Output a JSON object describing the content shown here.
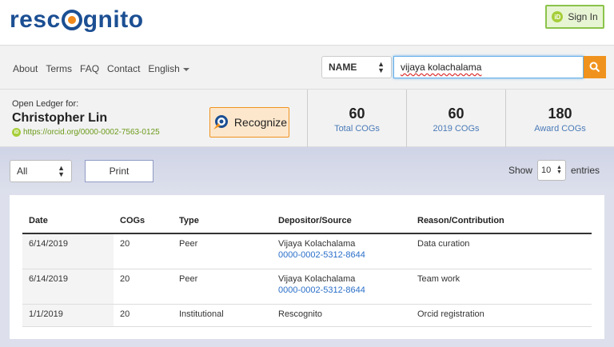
{
  "header": {
    "logo_text_left": "resc",
    "logo_text_right": "gnito",
    "signin_label": "Sign In",
    "orcid_badge": "iD"
  },
  "nav": {
    "links": [
      "About",
      "Terms",
      "FAQ",
      "Contact",
      "English"
    ],
    "search_type": "NAME",
    "search_value": "vijaya kolachalama"
  },
  "ledger": {
    "label": "Open Ledger for:",
    "name": "Christopher Lin",
    "orcid_url": "https://orcid.org/0000-0002-7563-0125",
    "recognize_label": "Recognize",
    "stats": [
      {
        "value": "60",
        "label": "Total COGs"
      },
      {
        "value": "60",
        "label": "2019 COGs"
      },
      {
        "value": "180",
        "label": "Award COGs"
      }
    ]
  },
  "controls": {
    "filter_value": "All",
    "print_label": "Print",
    "show_label": "Show",
    "entries_value": "10",
    "entries_label": "entries"
  },
  "table": {
    "headers": [
      "Date",
      "COGs",
      "Type",
      "Depositor/Source",
      "Reason/Contribution"
    ],
    "rows": [
      {
        "date": "6/14/2019",
        "cogs": "20",
        "type": "Peer",
        "depositor": "Vijaya Kolachalama",
        "depositor_id": "0000-0002-5312-8644",
        "reason": "Data curation"
      },
      {
        "date": "6/14/2019",
        "cogs": "20",
        "type": "Peer",
        "depositor": "Vijaya Kolachalama",
        "depositor_id": "0000-0002-5312-8644",
        "reason": "Team work"
      },
      {
        "date": "1/1/2019",
        "cogs": "20",
        "type": "Institutional",
        "depositor": "Rescognito",
        "depositor_id": "",
        "reason": "Orcid registration"
      }
    ]
  },
  "colors": {
    "brand_blue": "#1c4f93",
    "accent_orange": "#f0931e",
    "orcid_green": "#a6ce39",
    "link_blue": "#2a6fc9"
  }
}
